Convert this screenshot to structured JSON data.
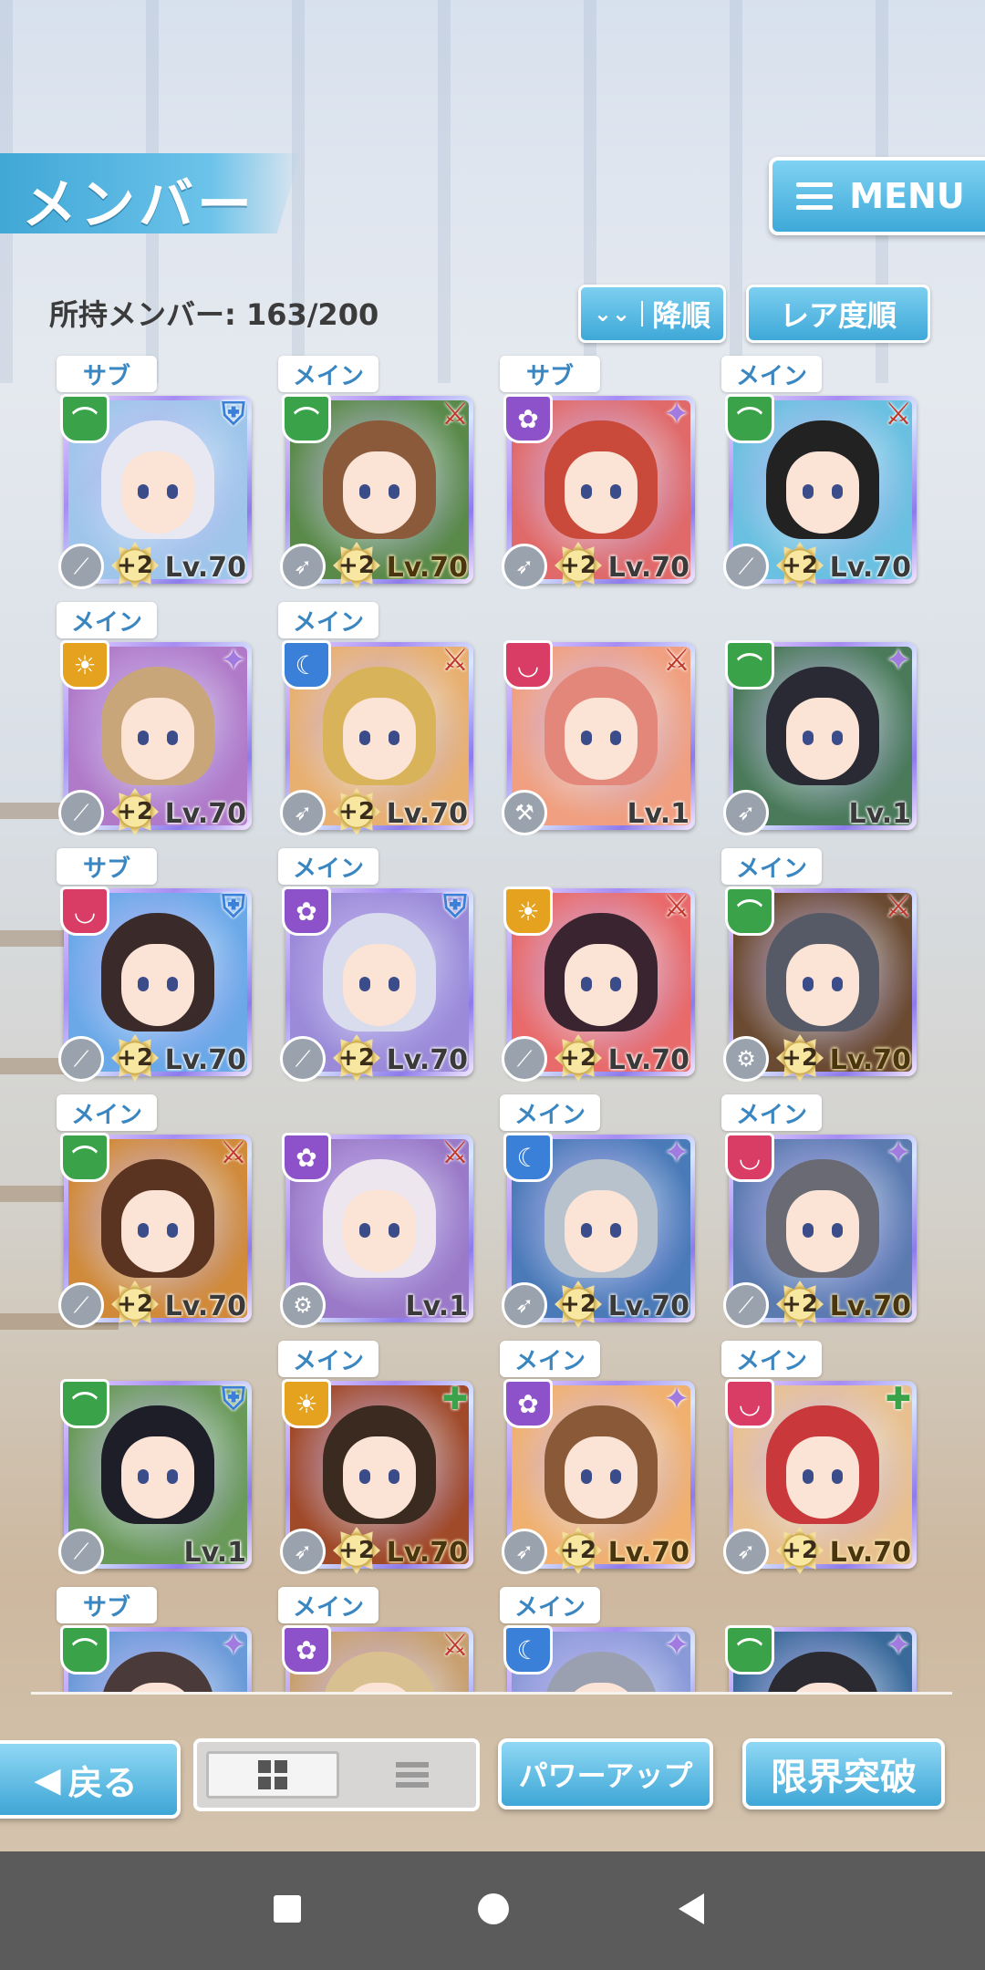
{
  "header": {
    "title": "メンバー",
    "menu_label": "MENU",
    "members_count": "所持メンバー: 163/200",
    "sort_order_label": "降順",
    "sort_key_label": "レア度順"
  },
  "colors": {
    "accent": "#3ea8d8",
    "attr_green": "#3aa34a",
    "attr_yellow": "#e4a21e",
    "attr_blue": "#3a7fd8",
    "attr_red": "#d93c64",
    "attr_purple": "#8d52c9"
  },
  "cards": [
    {
      "tag": "サブ",
      "attr": "green",
      "role": "shield",
      "lv": "Lv.70",
      "plus": "+2",
      "max": false,
      "weapon": "sword"
    },
    {
      "tag": "メイン",
      "attr": "green",
      "role": "sword",
      "lv": "Lv.70",
      "plus": "+2",
      "max": true,
      "weapon": "spear"
    },
    {
      "tag": "サブ",
      "attr": "purple",
      "role": "star",
      "lv": "Lv.70",
      "plus": "+2",
      "max": false,
      "weapon": "spear"
    },
    {
      "tag": "メイン",
      "attr": "green",
      "role": "sword",
      "lv": "Lv.70",
      "plus": "+2",
      "max": false,
      "weapon": "sword"
    },
    {
      "tag": "メイン",
      "attr": "yellow",
      "role": "star",
      "lv": "Lv.70",
      "plus": "+2",
      "max": false,
      "weapon": "sword"
    },
    {
      "tag": "メイン",
      "attr": "blue",
      "role": "sword",
      "lv": "Lv.70",
      "plus": "+2",
      "max": false,
      "weapon": "spear"
    },
    {
      "tag": "",
      "attr": "red",
      "role": "sword",
      "lv": "Lv.1",
      "plus": "",
      "max": false,
      "weapon": "axe"
    },
    {
      "tag": "",
      "attr": "green",
      "role": "star",
      "lv": "Lv.1",
      "plus": "",
      "max": false,
      "weapon": "spear"
    },
    {
      "tag": "サブ",
      "attr": "red",
      "role": "shield",
      "lv": "Lv.70",
      "plus": "+2",
      "max": false,
      "weapon": "sword"
    },
    {
      "tag": "メイン",
      "attr": "purple",
      "role": "shield",
      "lv": "Lv.70",
      "plus": "+2",
      "max": false,
      "weapon": "sword"
    },
    {
      "tag": "",
      "attr": "yellow",
      "role": "sword",
      "lv": "Lv.70",
      "plus": "+2",
      "max": false,
      "weapon": "sword"
    },
    {
      "tag": "メイン",
      "attr": "green",
      "role": "sword",
      "lv": "Lv.70",
      "plus": "+2",
      "max": true,
      "weapon": "gear"
    },
    {
      "tag": "メイン",
      "attr": "green",
      "role": "sword",
      "lv": "Lv.70",
      "plus": "+2",
      "max": false,
      "weapon": "sword"
    },
    {
      "tag": "",
      "attr": "purple",
      "role": "sword",
      "lv": "Lv.1",
      "plus": "",
      "max": false,
      "weapon": "gear"
    },
    {
      "tag": "メイン",
      "attr": "blue",
      "role": "star",
      "lv": "Lv.70",
      "plus": "+2",
      "max": false,
      "weapon": "spear"
    },
    {
      "tag": "メイン",
      "attr": "red",
      "role": "star",
      "lv": "Lv.70",
      "plus": "+2",
      "max": true,
      "weapon": "sword"
    },
    {
      "tag": "",
      "attr": "green",
      "role": "shield",
      "lv": "Lv.1",
      "plus": "",
      "max": false,
      "weapon": "sword"
    },
    {
      "tag": "メイン",
      "attr": "yellow",
      "role": "heal",
      "lv": "Lv.70",
      "plus": "+2",
      "max": true,
      "weapon": "spear"
    },
    {
      "tag": "メイン",
      "attr": "purple",
      "role": "star",
      "lv": "Lv.70",
      "plus": "+2",
      "max": true,
      "weapon": "spear"
    },
    {
      "tag": "メイン",
      "attr": "red",
      "role": "heal",
      "lv": "Lv.70",
      "plus": "+2",
      "max": true,
      "weapon": "spear"
    },
    {
      "tag": "サブ",
      "attr": "green",
      "role": "star",
      "lv": "",
      "plus": "",
      "max": false,
      "weapon": ""
    },
    {
      "tag": "メイン",
      "attr": "purple",
      "role": "sword",
      "lv": "",
      "plus": "",
      "max": false,
      "weapon": ""
    },
    {
      "tag": "メイン",
      "attr": "blue",
      "role": "star",
      "lv": "",
      "plus": "",
      "max": false,
      "weapon": ""
    },
    {
      "tag": "",
      "attr": "green",
      "role": "star",
      "lv": "",
      "plus": "",
      "max": false,
      "weapon": ""
    }
  ],
  "footer": {
    "back_label": "戻る",
    "power_up_label": "パワーアップ",
    "limit_break_label": "限界突破"
  }
}
